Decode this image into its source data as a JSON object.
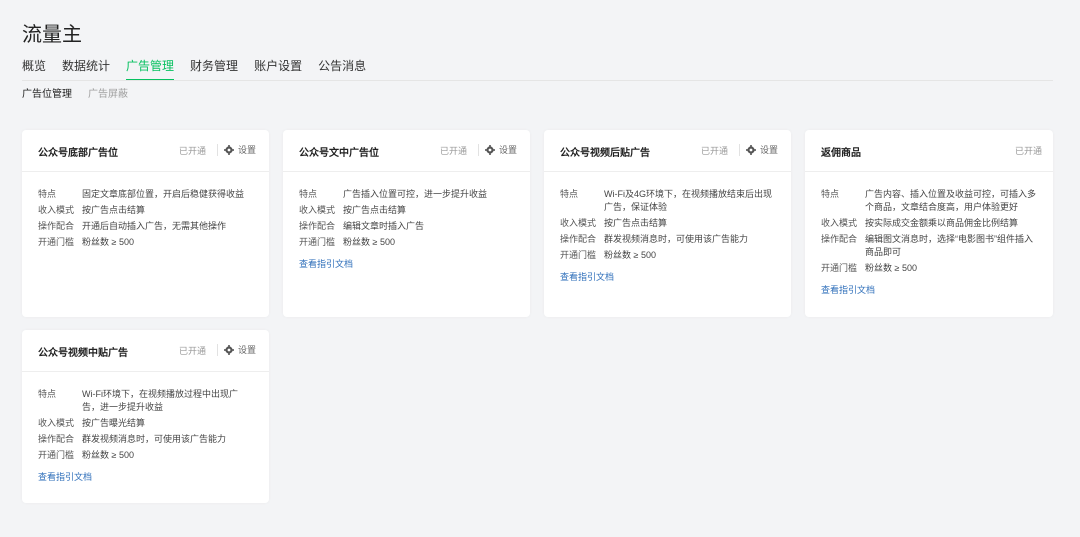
{
  "header": {
    "title": "流量主"
  },
  "tabs": [
    {
      "label": "概览"
    },
    {
      "label": "数据统计"
    },
    {
      "label": "广告管理"
    },
    {
      "label": "财务管理"
    },
    {
      "label": "账户设置"
    },
    {
      "label": "公告消息"
    }
  ],
  "subtabs": [
    {
      "label": "广告位管理"
    },
    {
      "label": "广告屏蔽"
    }
  ],
  "row_labels": {
    "feature": "特点",
    "income": "收入模式",
    "operation": "操作配合",
    "threshold": "开通门槛"
  },
  "cards": [
    {
      "title": "公众号底部广告位",
      "status": "已开通",
      "settings": "设置",
      "feature": "固定文章底部位置，开启后稳健获得收益",
      "income": "按广告点击结算",
      "operation": "开通后自动插入广告，无需其他操作",
      "threshold": "粉丝数 ≥ 500"
    },
    {
      "title": "公众号文中广告位",
      "status": "已开通",
      "settings": "设置",
      "feature": "广告插入位置可控，进一步提升收益",
      "income": "按广告点击结算",
      "operation": "编辑文章时插入广告",
      "threshold": "粉丝数 ≥ 500",
      "link": "查看指引文档"
    },
    {
      "title": "公众号视频后贴广告",
      "status": "已开通",
      "settings": "设置",
      "feature": "Wi-Fi及4G环境下，在视频播放结束后出现广告，保证体验",
      "income": "按广告点击结算",
      "operation": "群发视频消息时，可使用该广告能力",
      "threshold": "粉丝数 ≥ 500",
      "link": "查看指引文档"
    },
    {
      "title": "返佣商品",
      "status": "已开通",
      "feature": "广告内容、插入位置及收益可控，可插入多个商品，文章结合度高，用户体验更好",
      "income": "按实际成交金额乘以商品佣金比例结算",
      "operation": "编辑图文消息时，选择“电影图书”组件插入商品即可",
      "threshold": "粉丝数 ≥ 500",
      "link": "查看指引文档"
    },
    {
      "title": "公众号视频中贴广告",
      "status": "已开通",
      "settings": "设置",
      "feature": "Wi-Fi环境下，在视频播放过程中出现广告，进一步提升收益",
      "income": "按广告曝光结算",
      "operation": "群发视频消息时，可使用该广告能力",
      "threshold": "粉丝数 ≥ 500",
      "link": "查看指引文档"
    }
  ]
}
